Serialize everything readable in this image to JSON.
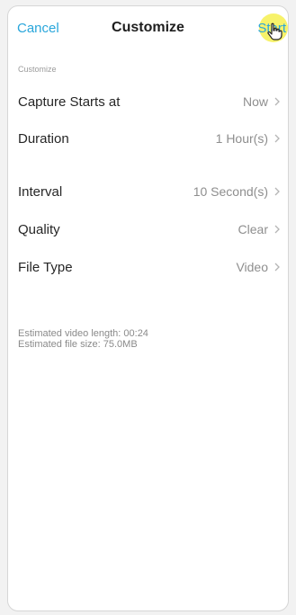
{
  "nav": {
    "cancel_label": "Cancel",
    "title": "Customize",
    "start_label": "Start"
  },
  "section": {
    "label": "Customize"
  },
  "rows": [
    {
      "label": "Capture Starts at",
      "value": "Now"
    },
    {
      "label": "Duration",
      "value": "1 Hour(s)"
    },
    {
      "label": "Interval",
      "value": "10 Second(s)"
    },
    {
      "label": "Quality",
      "value": "Clear"
    },
    {
      "label": "File Type",
      "value": "Video"
    }
  ],
  "info": {
    "video_length": "Estimated video length: 00:24",
    "file_size": "Estimated file size: 75.0MB"
  },
  "icons": {
    "chevron": "chevron-right-icon",
    "cursor": "hand-pointer-icon"
  },
  "colors": {
    "accent": "#29a6db",
    "cursor_highlight": "#f6f050"
  }
}
